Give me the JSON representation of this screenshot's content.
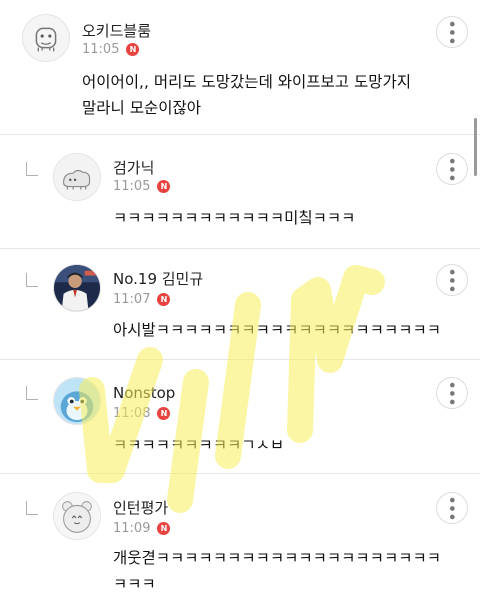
{
  "comments": [
    {
      "name": "오키드블룸",
      "time": "11:05",
      "badge": "N",
      "lines": [
        "어이어이,, 머리도 도망갔는데 와이프보고 도망가지",
        "말라니 모순이잖아"
      ],
      "avatar": "mascot-face-icon"
    },
    {
      "name": "검가닉",
      "time": "11:05",
      "badge": "N",
      "lines": [
        "ㅋㅋㅋㅋㅋㅋㅋㅋㅋㅋㅋㅋ미칰ㅋㅋㅋ"
      ],
      "avatar": "sheep-icon"
    },
    {
      "name": "No.19 김민규",
      "time": "11:07",
      "badge": "N",
      "lines": [
        "아시발ㅋㅋㅋㅋㅋㅋㅋㅋㅋㅋㅋㅋㅋㅋㅋㅋㅋㅋㅋㅋ"
      ],
      "avatar": "player-photo"
    },
    {
      "name": "Nonstop",
      "time": "11:08",
      "badge": "N",
      "lines": [
        "ㅋㅋㅋㅋㅋㅋㅋㅋㅋㄱㅅㅂ"
      ],
      "avatar": "penguin-icon"
    },
    {
      "name": "인턴평가",
      "time": "11:09",
      "badge": "N",
      "lines": [
        "개웃겯ㅋㅋㅋㅋㅋㅋㅋㅋㅋㅋㅋㅋㅋㅋㅋㅋㅋㅋㅋㅋ",
        "ㅋㅋㅋ"
      ],
      "avatar": "bear-icon"
    }
  ],
  "more_label": "•••",
  "colors": {
    "badge": "#e8433f",
    "watermark": "#f5ee6a"
  }
}
